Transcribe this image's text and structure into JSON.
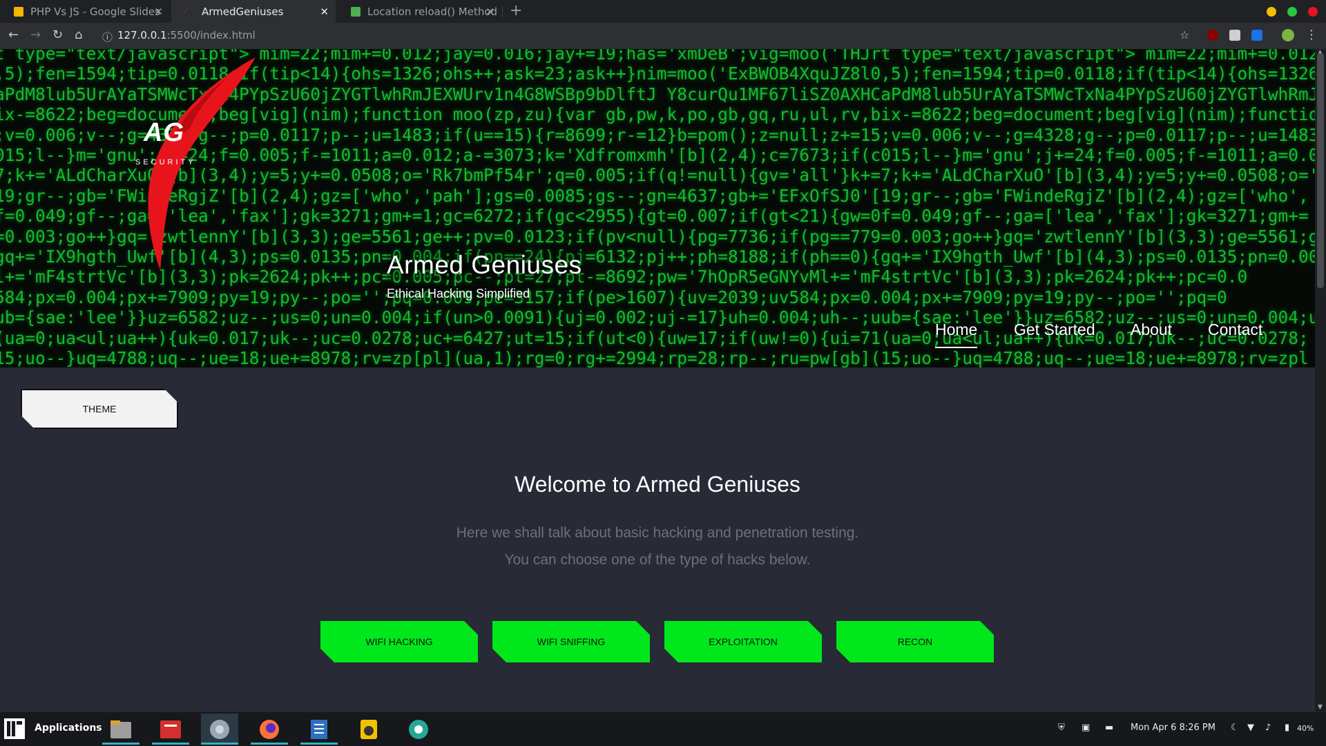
{
  "browser": {
    "tabs": [
      {
        "title": "PHP Vs JS - Google Slides",
        "icon": "google-slides-icon",
        "active": false
      },
      {
        "title": "ArmedGeniuses",
        "icon": "armedgeniuses-favicon",
        "active": true
      },
      {
        "title": "Location reload() Method",
        "icon": "w3schools-icon",
        "active": false
      }
    ],
    "url_host": "127.0.0.1",
    "url_path": ":5500/index.html"
  },
  "hero": {
    "logo_text": "AG",
    "logo_subtext": "SECURITY",
    "site_title": "Armed Geniuses",
    "tagline": "Ethical Hacking Simplified",
    "nav": [
      {
        "label": "Home",
        "active": true
      },
      {
        "label": "Get Started",
        "active": false
      },
      {
        "label": "About",
        "active": false
      },
      {
        "label": "Contact",
        "active": false
      }
    ],
    "matrix_lines": [
      "t type=\"text/javascript\"> mim=22;mim+=0.012;jay=0.016;jay+=19;has='xmDeB';vig=moo('THJrt type=\"text/javascript\"> mim=22;mim+=0.012",
      ",5);fen=1594;tip=0.0118;if(tip<14){ohs=1326;ohs++;ask=23;ask++}nim=moo('ExBWOB4XquJZ8l0,5);fen=1594;tip=0.0118;if(tip<14){ohs=1326",
      "aPdM8lub5UrAYaTSMWcTxNa4PYpSzU60jZYGTlwhRmJEXWUrv1n4G8WSBp9bDlftJ Y8curQu1MF67liSZ0AXHCaPdM8lub5UrAYaTSMWcTxNa4PYpSzU60jZYGTlwhRmJ",
      "ix-=8622;beg=document;beg[vig](nim);function moo(zp,zu){var gb,pw,k,po,gb,gq,ru,ul,rv,bix-=8622;beg=document;beg[vig](nim);functio",
      ";v=0.006;v--;g=4328;g--;p=0.0117;p--;u=1483;if(u==15){r=8699;r-=12}b=pom();z=null;z+=15;v=0.006;v--;g=4328;g--;p=0.0117;p--;u=1483",
      "015;l--}m='gnu';j+=24;f=0.005;f-=1011;a=0.012;a-=3073;k='Xdfromxmh'[b](2,4);c=7673;if(c015;l--}m='gnu';j+=24;f=0.005;f-=1011;a=0.0",
      "7;k+='ALdCharXuO'[b](3,4);y=5;y+=0.0508;o='Rk7bmPf54r';q=0.005;if(q!=null){gv='all'}k+=7;k+='ALdCharXuO'[b](3,4);y=5;y+=0.0508;o='",
      "19;gr--;gb='FWindeRgjZ'[b](2,4);gz=['who','pah'];gs=0.0085;gs--;gn=4637;gb+='EFxOfSJ0'[19;gr--;gb='FWindeRgjZ'[b](2,4);gz=['who',",
      "f=0.049;gf--;ga=['lea','fax'];gk=3271;gm+=1;gc=6272;if(gc<2955){gt=0.007;if(gt<21){gw=0f=0.049;gf--;ga=['lea','fax'];gk=3271;gm+=",
      "=0.003;go++}gq='zwtlennY'[b](3,3);ge=5561;ge++;pv=0.0123;if(pv<null){pg=7736;if(pg==779=0.003;go++}gq='zwtlennY'[b](3,3);ge=5561;g",
      "gq+='IX9hgth_Uwf'[b](4,3);ps=0.0135;pn=0.004;if(pn==24){pj=6132;pj++;ph=8188;if(ph==0){gq+='IX9hgth_Uwf'[b](4,3);ps=0.0135;pn=0.00",
      "l+='mF4strtVc'[b](3,3);pk=2624;pk++;pc=0.005;pc--;pt=27;pt-=8692;pw='7hOpR5eGNYvMl+='mF4strtVc'[b](3,3);pk=2624;pk++;pc=0.0",
      "584;px=0.004;px+=7909;py=19;py--;po='';pq=0.009;pe=3157;if(pe>1607){uv=2039;uv584;px=0.004;px+=7909;py=19;py--;po='';pq=0",
      "ub={sae:'lee'}}uz=6582;uz--;us=0;un=0.004;if(un>0.0091){uj=0.002;uj-=17}uh=0.004;uh--;uub={sae:'lee'}}uz=6582;uz--;us=0;un=0.004;u",
      "(ua=0;ua<ul;ua++){uk=0.017;uk--;uc=0.0278;uc+=6427;ut=15;if(ut<0){uw=17;if(uw!=0){ui=71(ua=0;ua<ul;ua++){uk=0.017;uk--;uc=0.0278;",
      "15;uo--}uq=4788;uq--;ue=18;ue+=8978;rv=zp[pl](ua,1);rg=0;rg+=2994;rp=28;rp--;ru=pw[gb](15;uo--}uq=4788;uq--;ue=18;ue+=8978;rv=zpl"
    ]
  },
  "theme_button": {
    "label": "THEME"
  },
  "main": {
    "welcome": "Welcome to Armed Geniuses",
    "desc_line1": "Here we shall talk about basic hacking and penetration testing.",
    "desc_line2": "You can choose one of the type of hacks below.",
    "hack_buttons": [
      "WIFI HACKING",
      "WIFI SNIFFING",
      "EXPLOITATION",
      "RECON"
    ]
  },
  "taskbar": {
    "applications_label": "Applications",
    "datetime": "Mon Apr 6   8:26 PM",
    "battery": "40%"
  },
  "colors": {
    "matrix_green": "#14c530",
    "button_green": "#00e81c",
    "page_bg": "#282a36",
    "logo_red": "#e8141c"
  }
}
